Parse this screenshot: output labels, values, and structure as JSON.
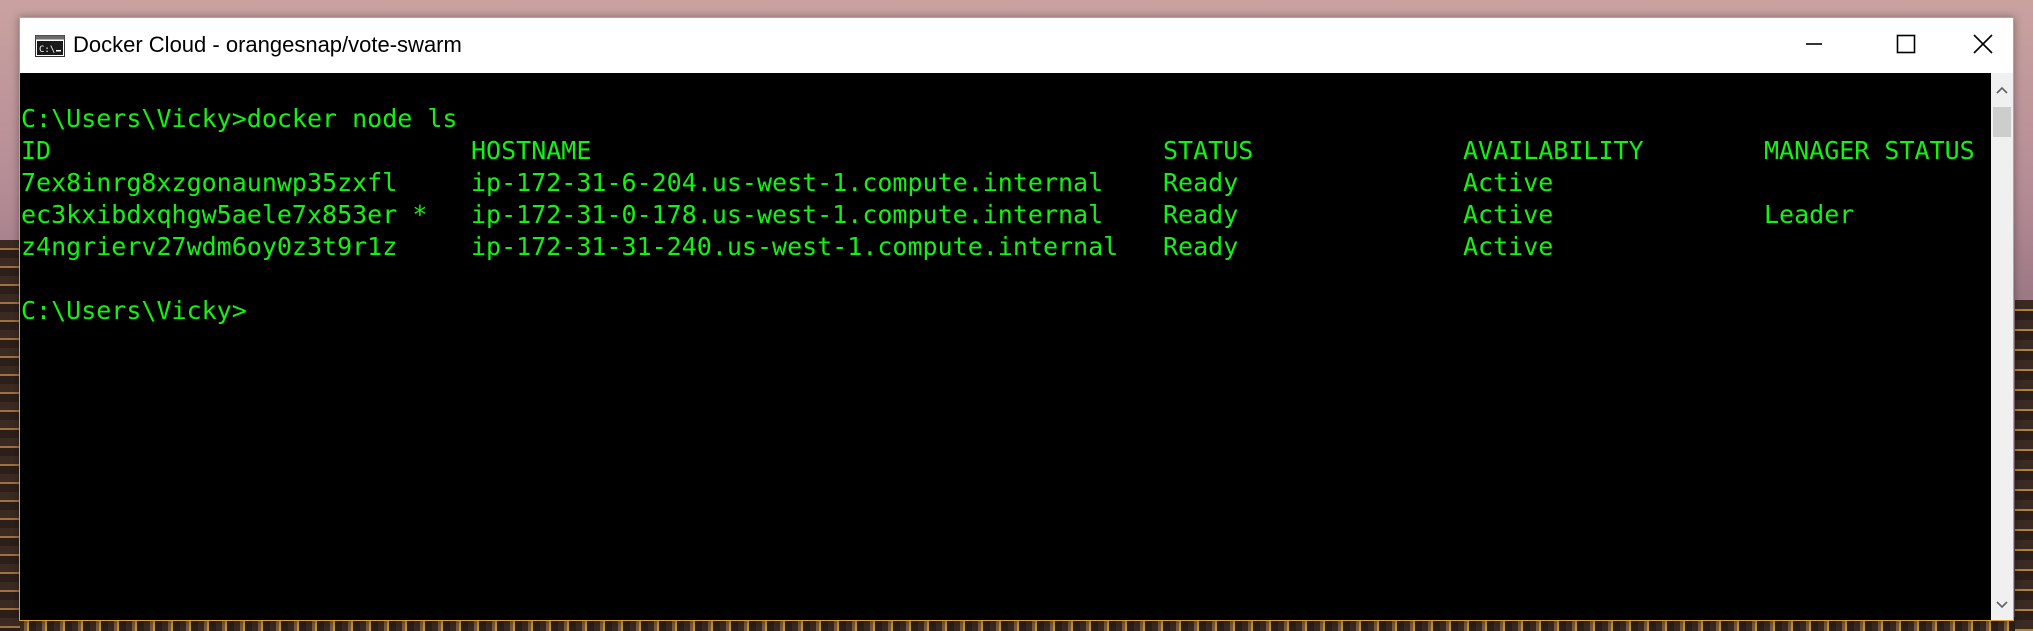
{
  "window": {
    "title": "Docker Cloud - orangesnap/vote-swarm",
    "icon": "console-icon",
    "border_color": "#e0a030"
  },
  "console": {
    "text_color": "#13f313",
    "background": "#000000",
    "command_line": "C:\\Users\\Vicky>docker node ls",
    "headers": {
      "id": "ID",
      "hostname": "HOSTNAME",
      "status": "STATUS",
      "availability": "AVAILABILITY",
      "manager_status": "MANAGER STATUS"
    },
    "rows": [
      {
        "id": "7ex8inrg8xzgonaunwp35zxfl",
        "hostname": "ip-172-31-6-204.us-west-1.compute.internal",
        "status": "Ready",
        "availability": "Active",
        "manager_status": ""
      },
      {
        "id": "ec3kxibdxqhgw5aele7x853er *",
        "hostname": "ip-172-31-0-178.us-west-1.compute.internal",
        "status": "Ready",
        "availability": "Active",
        "manager_status": "Leader"
      },
      {
        "id": "z4ngrierv27wdm6oy0z3t9r1z",
        "hostname": "ip-172-31-31-240.us-west-1.compute.internal",
        "status": "Ready",
        "availability": "Active",
        "manager_status": ""
      }
    ],
    "prompt": "C:\\Users\\Vicky>"
  },
  "controls": {
    "minimize": "minimize-icon",
    "maximize": "maximize-icon",
    "close": "close-icon"
  }
}
